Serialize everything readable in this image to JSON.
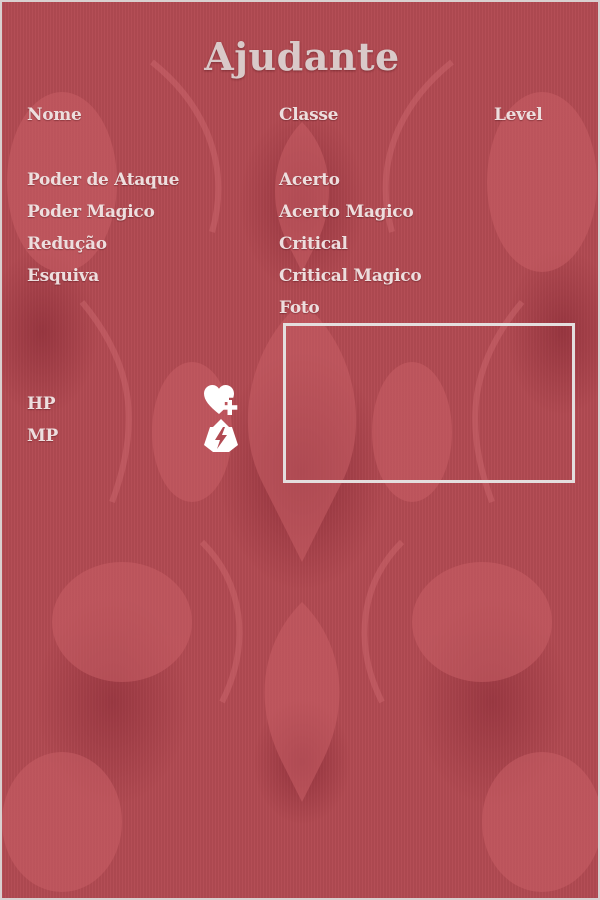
{
  "title": "Ajudante",
  "header": {
    "name_label": "Nome",
    "class_label": "Classe",
    "level_label": "Level"
  },
  "stats_left": [
    "Poder de Ataque",
    "Poder Magico",
    "Redução",
    "Esquiva"
  ],
  "stats_right": [
    "Acerto",
    "Acerto Magico",
    "Critical",
    "Critical Magico",
    "Foto"
  ],
  "vitals": {
    "hp_label": "HP",
    "mp_label": "MP"
  },
  "icons": {
    "hp": "heart-plus-icon",
    "mp": "lightning-shield-icon"
  },
  "colors": {
    "background": "#b24a52",
    "text": "#eddede",
    "frame": "#e4dede"
  }
}
